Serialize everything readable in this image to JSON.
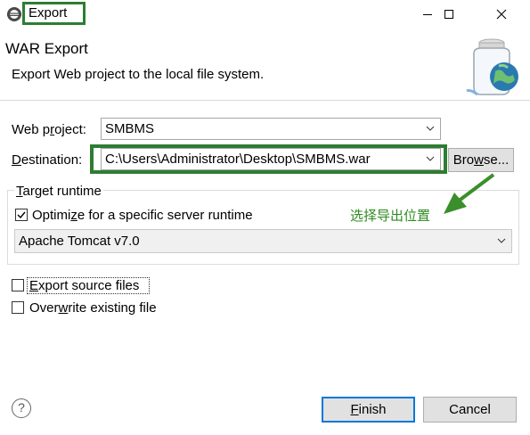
{
  "window": {
    "title": "Export",
    "highlight_color": "#2e7d32"
  },
  "banner": {
    "title": "WAR Export",
    "description": "Export Web project to the local file system."
  },
  "form": {
    "web_project_label": "Web project:",
    "web_project_value": "SMBMS",
    "destination_label": "Destination:",
    "destination_value": "C:\\Users\\Administrator\\Desktop\\SMBMS.war",
    "browse_label": "Browse...",
    "target_runtime_label": "Target runtime",
    "optimize_label": "Optimize for a specific server runtime",
    "optimize_checked": true,
    "runtime_value": "Apache Tomcat v7.0",
    "export_source_label": "Export source files",
    "export_source_checked": false,
    "overwrite_label": "Overwrite existing file",
    "overwrite_checked": false
  },
  "annotation": {
    "text": "选择导出位置",
    "color": "#2e8b22"
  },
  "footer": {
    "help_icon": "question-icon",
    "finish_label": "Finish",
    "cancel_label": "Cancel"
  }
}
